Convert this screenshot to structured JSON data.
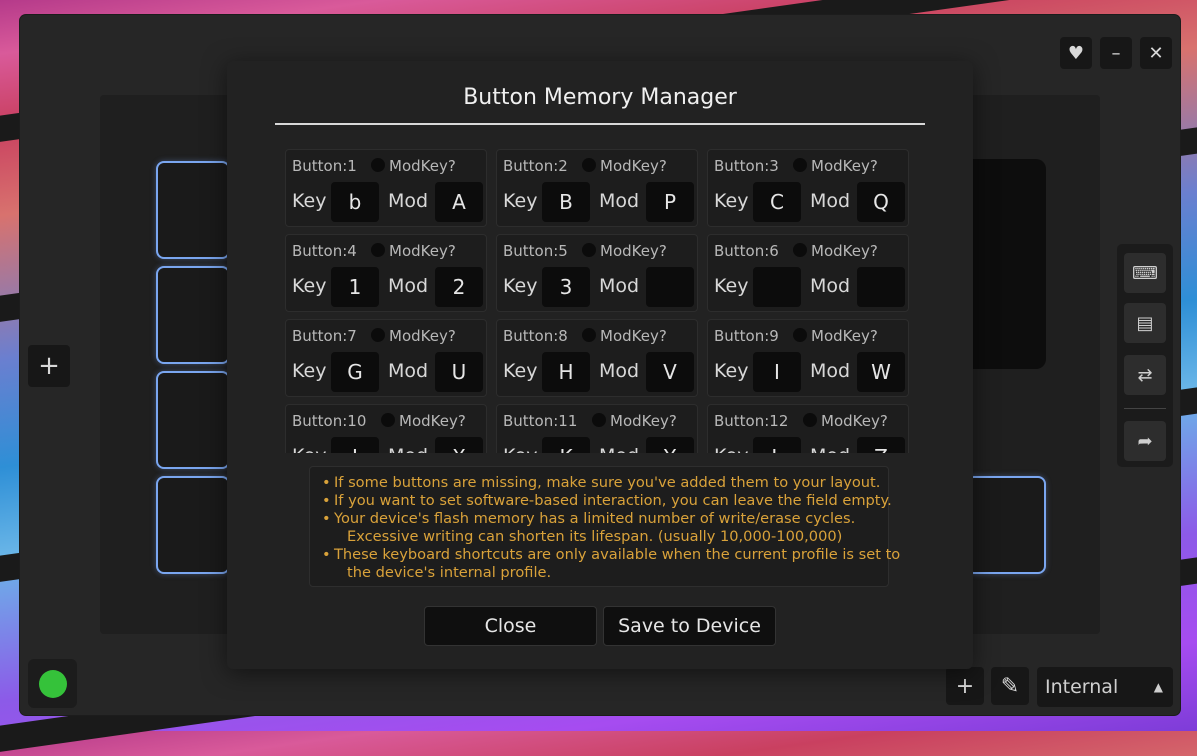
{
  "window": {
    "controls": [
      {
        "name": "favorite",
        "icon": "heart-icon",
        "glyph": "♥"
      },
      {
        "name": "minimize",
        "icon": "minimize-icon",
        "glyph": "–"
      },
      {
        "name": "close",
        "icon": "close-icon",
        "glyph": "✕"
      }
    ]
  },
  "side": {
    "add_glyph": "+"
  },
  "toolbar": {
    "keyboard_icon": "⌨",
    "memory_icon": "▤",
    "swap_icon": "⇄",
    "forward_icon": "➦"
  },
  "bottom_bar": {
    "add_glyph": "+",
    "edit_glyph": "✎",
    "profile_value": "Internal",
    "caret": "▲",
    "status_color": "#35c23a"
  },
  "modal": {
    "title": "Button Memory Manager",
    "modkey_label": "ModKey?",
    "key_label": "Key",
    "mod_label": "Mod",
    "buttons": [
      {
        "title": "Button:1",
        "key": "b",
        "mod": "A"
      },
      {
        "title": "Button:2",
        "key": "B",
        "mod": "P"
      },
      {
        "title": "Button:3",
        "key": "C",
        "mod": "Q"
      },
      {
        "title": "Button:4",
        "key": "1",
        "mod": "2"
      },
      {
        "title": "Button:5",
        "key": "3",
        "mod": ""
      },
      {
        "title": "Button:6",
        "key": "",
        "mod": ""
      },
      {
        "title": "Button:7",
        "key": "G",
        "mod": "U"
      },
      {
        "title": "Button:8",
        "key": "H",
        "mod": "V"
      },
      {
        "title": "Button:9",
        "key": "I",
        "mod": "W"
      },
      {
        "title": "Button:10",
        "key": "J",
        "mod": "X"
      },
      {
        "title": "Button:11",
        "key": "K",
        "mod": "Y"
      },
      {
        "title": "Button:12",
        "key": "L",
        "mod": "Z"
      }
    ],
    "info_lines": [
      {
        "bullet": "•",
        "text": "If some buttons are missing, make sure you've added them to your layout."
      },
      {
        "bullet": "•",
        "text": "If you want to set software-based interaction, you can leave the field empty."
      },
      {
        "bullet": "•",
        "text": "Your device's flash memory has a limited number of write/erase cycles."
      },
      {
        "bullet": "",
        "text": "Excessive writing can shorten its lifespan. (usually 10,000-100,000)"
      },
      {
        "bullet": "•",
        "text": "These keyboard shortcuts are only available when the current profile is set to"
      },
      {
        "bullet": "",
        "text": "the device's internal profile."
      }
    ],
    "close_label": "Close",
    "save_label": "Save to Device",
    "accent_info_color": "#d9a23a",
    "layout_outline_color": "#7aa6f0"
  }
}
